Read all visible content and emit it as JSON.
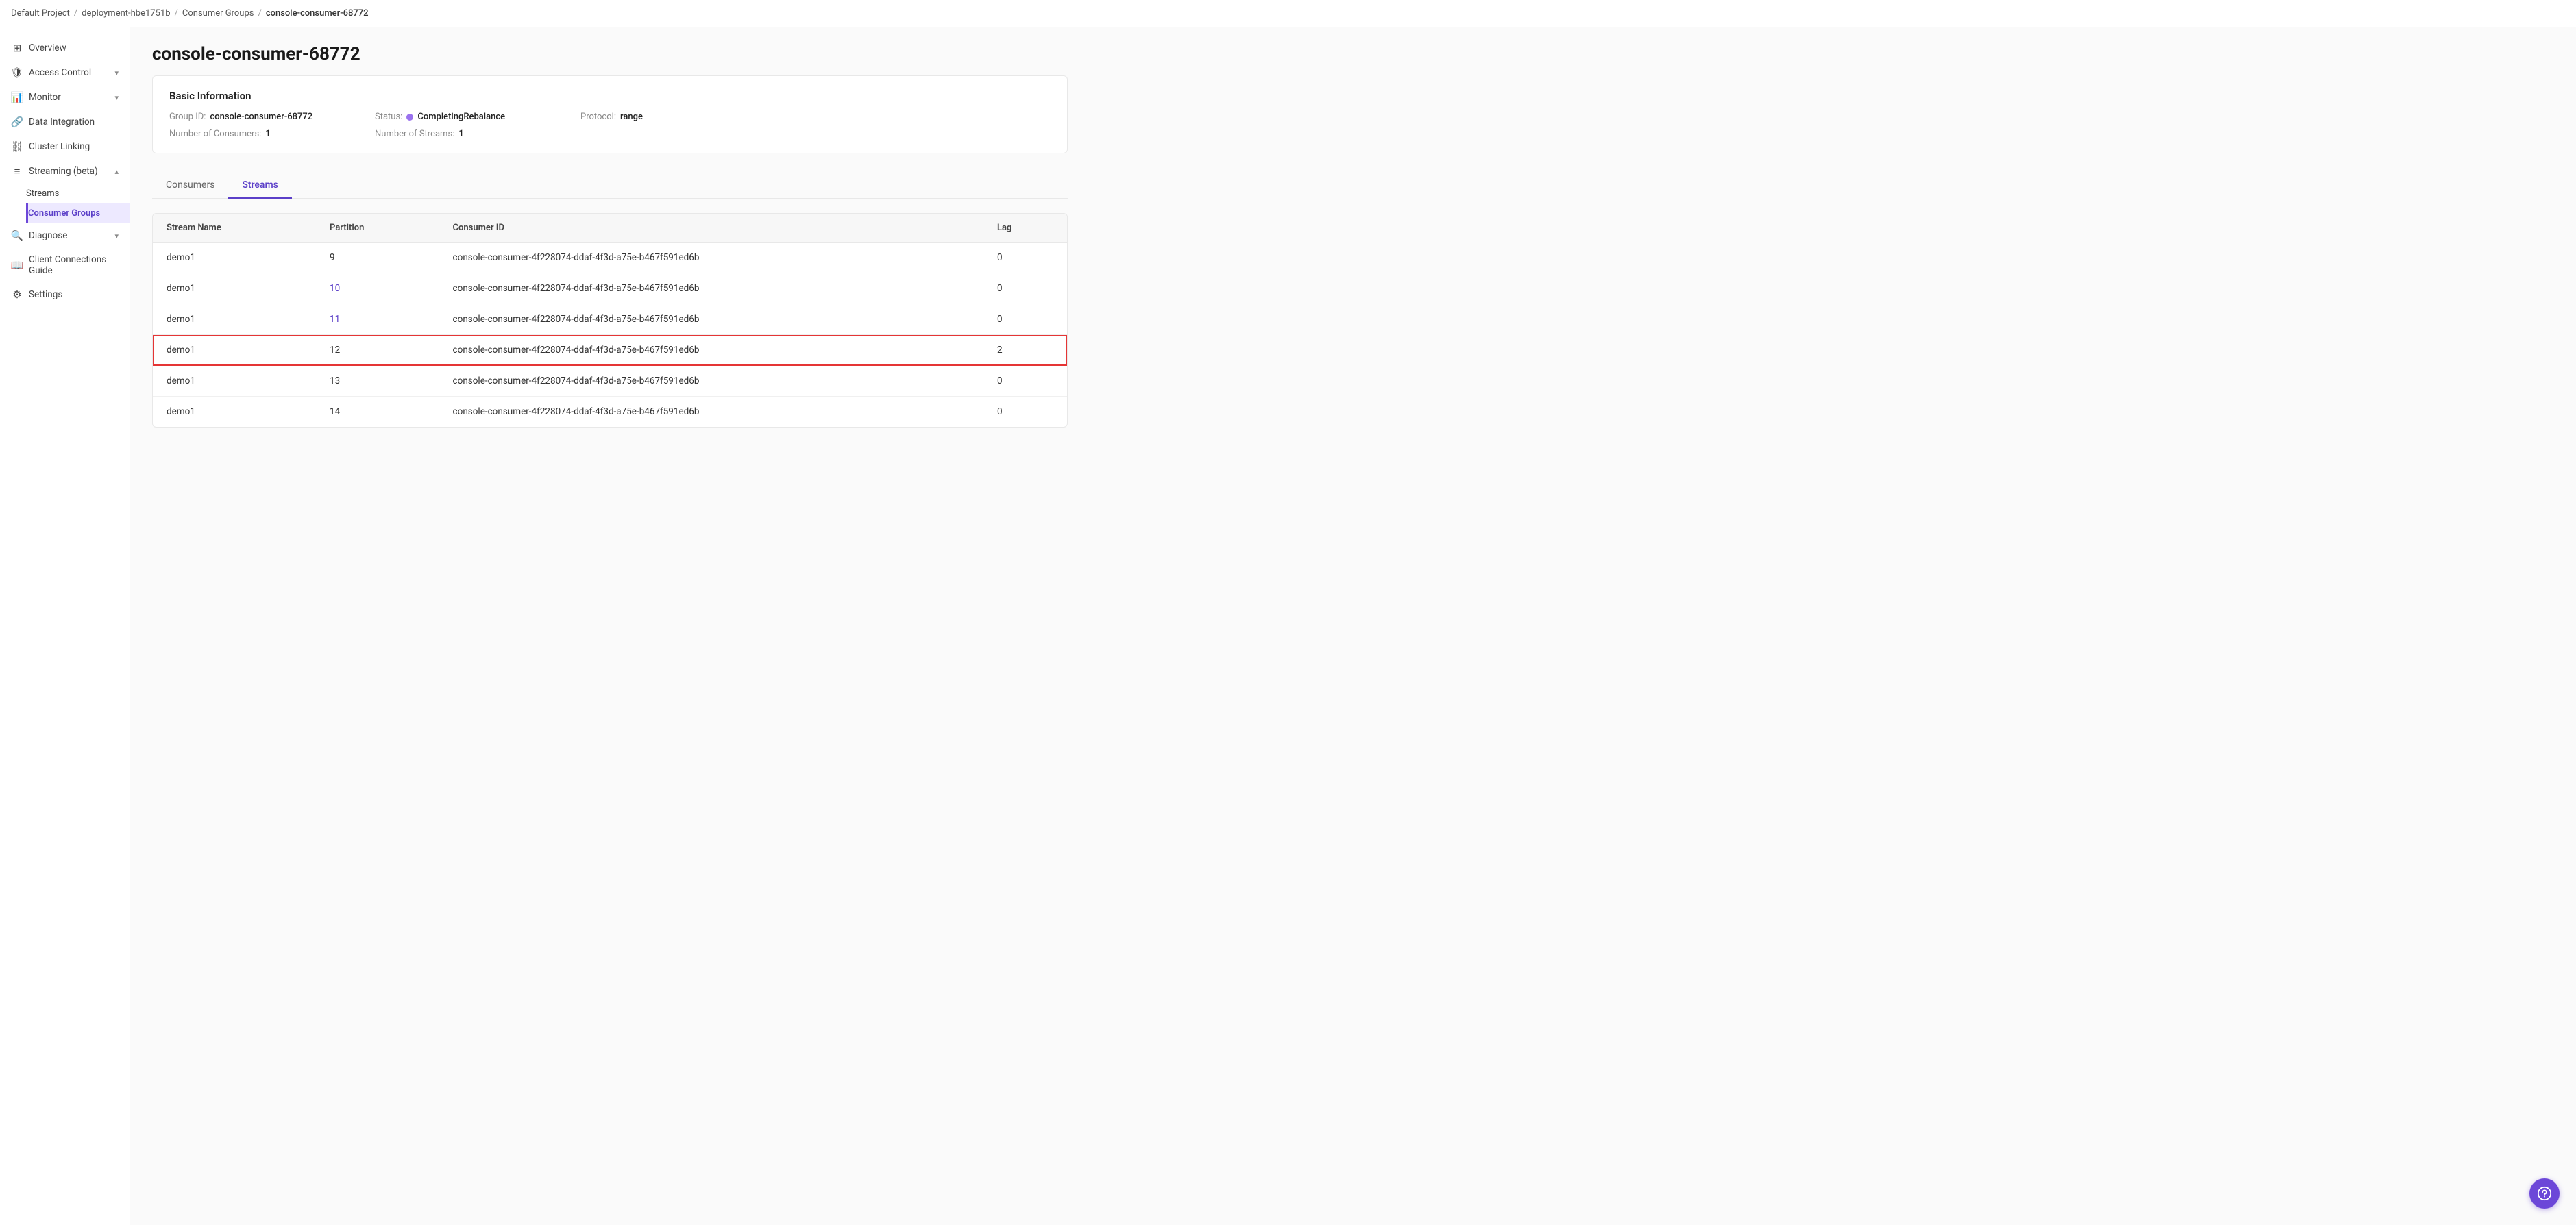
{
  "breadcrumb": {
    "items": [
      {
        "label": "Default Project",
        "href": "#"
      },
      {
        "label": "deployment-hbe1751b",
        "href": "#"
      },
      {
        "label": "Consumer Groups",
        "href": "#"
      },
      {
        "label": "console-consumer-68772",
        "href": "#",
        "current": true
      }
    ]
  },
  "sidebar": {
    "items": [
      {
        "id": "overview",
        "label": "Overview",
        "icon": "⊞",
        "active": false
      },
      {
        "id": "access-control",
        "label": "Access Control",
        "icon": "🛡",
        "active": false,
        "hasChevron": true
      },
      {
        "id": "monitor",
        "label": "Monitor",
        "icon": "📊",
        "active": false,
        "hasChevron": true
      },
      {
        "id": "data-integration",
        "label": "Data Integration",
        "icon": "🔗",
        "active": false
      },
      {
        "id": "cluster-linking",
        "label": "Cluster Linking",
        "icon": "⛓",
        "active": false
      },
      {
        "id": "streaming-beta",
        "label": "Streaming (beta)",
        "icon": "≡",
        "active": false,
        "hasChevron": true,
        "expanded": true
      },
      {
        "id": "streams",
        "label": "Streams",
        "icon": "",
        "active": false,
        "sub": true
      },
      {
        "id": "consumer-groups",
        "label": "Consumer Groups",
        "icon": "",
        "active": true,
        "sub": true
      },
      {
        "id": "diagnose",
        "label": "Diagnose",
        "icon": "🔍",
        "active": false,
        "hasChevron": true
      },
      {
        "id": "client-connections",
        "label": "Client Connections Guide",
        "icon": "📖",
        "active": false
      },
      {
        "id": "settings",
        "label": "Settings",
        "icon": "⚙",
        "active": false
      }
    ]
  },
  "page": {
    "title": "console-consumer-68772",
    "basicInfoTitle": "Basic Information",
    "fields": {
      "groupId": {
        "label": "Group ID:",
        "value": "console-consumer-68772"
      },
      "status": {
        "label": "Status:",
        "value": "CompletingRebalance"
      },
      "protocol": {
        "label": "Protocol:",
        "value": "range"
      },
      "numConsumers": {
        "label": "Number of Consumers:",
        "value": "1"
      },
      "numStreams": {
        "label": "Number of Streams:",
        "value": "1"
      }
    }
  },
  "tabs": [
    {
      "id": "consumers",
      "label": "Consumers",
      "active": false
    },
    {
      "id": "streams",
      "label": "Streams",
      "active": true
    }
  ],
  "table": {
    "columns": [
      {
        "id": "stream-name",
        "label": "Stream Name"
      },
      {
        "id": "partition",
        "label": "Partition"
      },
      {
        "id": "consumer-id",
        "label": "Consumer ID"
      },
      {
        "id": "lag",
        "label": "Lag"
      }
    ],
    "rows": [
      {
        "stream": "demo1",
        "partition": "9",
        "partitionLink": false,
        "consumerId": "console-consumer-4f228074-ddaf-4f3d-a75e-b467f591ed6b",
        "lag": "0",
        "highlighted": false
      },
      {
        "stream": "demo1",
        "partition": "10",
        "partitionLink": true,
        "consumerId": "console-consumer-4f228074-ddaf-4f3d-a75e-b467f591ed6b",
        "lag": "0",
        "highlighted": false
      },
      {
        "stream": "demo1",
        "partition": "11",
        "partitionLink": true,
        "consumerId": "console-consumer-4f228074-ddaf-4f3d-a75e-b467f591ed6b",
        "lag": "0",
        "highlighted": false
      },
      {
        "stream": "demo1",
        "partition": "12",
        "partitionLink": false,
        "consumerId": "console-consumer-4f228074-ddaf-4f3d-a75e-b467f591ed6b",
        "lag": "2",
        "highlighted": true
      },
      {
        "stream": "demo1",
        "partition": "13",
        "partitionLink": false,
        "consumerId": "console-consumer-4f228074-ddaf-4f3d-a75e-b467f591ed6b",
        "lag": "0",
        "highlighted": false
      },
      {
        "stream": "demo1",
        "partition": "14",
        "partitionLink": false,
        "consumerId": "console-consumer-4f228074-ddaf-4f3d-a75e-b467f591ed6b",
        "lag": "0",
        "highlighted": false
      }
    ]
  }
}
